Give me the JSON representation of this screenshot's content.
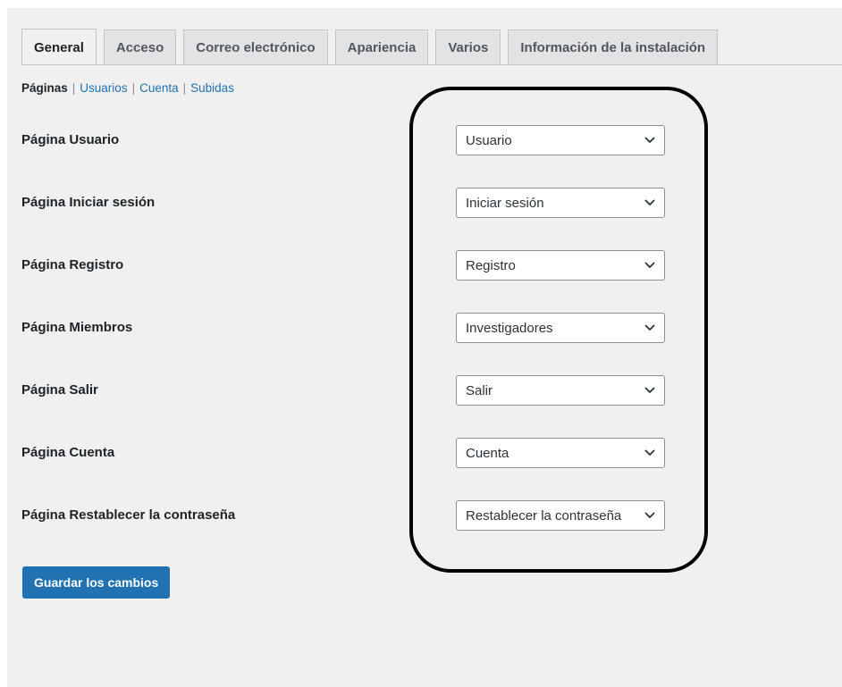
{
  "tabs": [
    {
      "label": "General",
      "active": true
    },
    {
      "label": "Acceso",
      "active": false
    },
    {
      "label": "Correo electrónico",
      "active": false
    },
    {
      "label": "Apariencia",
      "active": false
    },
    {
      "label": "Varios",
      "active": false
    },
    {
      "label": "Información de la instalación",
      "active": false
    }
  ],
  "subnav": {
    "current": "Páginas",
    "links": [
      "Usuarios",
      "Cuenta",
      "Subidas"
    ],
    "separator": "|"
  },
  "rows": [
    {
      "label": "Página Usuario",
      "value": "Usuario"
    },
    {
      "label": "Página Iniciar sesión",
      "value": "Iniciar sesión"
    },
    {
      "label": "Página Registro",
      "value": "Registro"
    },
    {
      "label": "Página Miembros",
      "value": "Investigadores"
    },
    {
      "label": "Página Salir",
      "value": "Salir"
    },
    {
      "label": "Página Cuenta",
      "value": "Cuenta"
    },
    {
      "label": "Página Restablecer la contraseña",
      "value": "Restablecer la contraseña"
    }
  ],
  "save_button": "Guardar los cambios",
  "colors": {
    "background": "#f0f0f1",
    "link": "#2271b1",
    "primary_button": "#2271b1",
    "highlight_outline": "#000000"
  },
  "icons": {
    "select_arrow": "chevron-down-icon"
  }
}
